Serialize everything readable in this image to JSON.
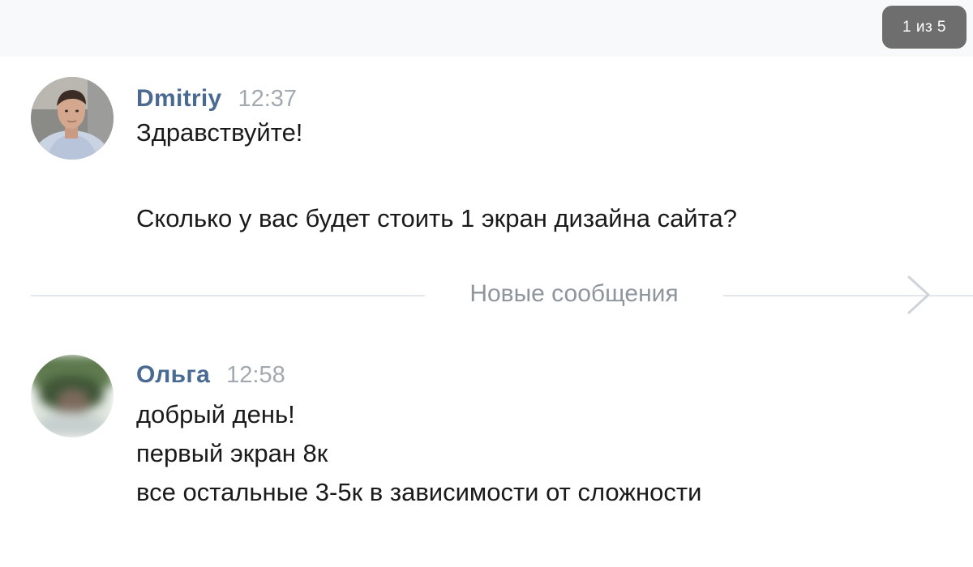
{
  "pagination": {
    "label": "1 из 5"
  },
  "colors": {
    "author": "#4a6a92",
    "time": "#a3a9b0",
    "text": "#1a1a1a",
    "divider_text": "#8e959c",
    "counter_bg": "#6e6e6e"
  },
  "messages": [
    {
      "author": "Dmitriy",
      "time": "12:37",
      "avatar_icon": "user-photo-avatar",
      "lines": [
        "Здравствуйте!",
        "Сколько у вас будет стоить 1 экран дизайна сайта?"
      ]
    },
    {
      "author": "Ольга",
      "time": "12:58",
      "avatar_icon": "blurred-user-avatar",
      "lines": [
        "добрый день!",
        "первый экран 8к",
        "все остальные 3-5к в зависимости от сложности"
      ]
    }
  ],
  "divider": {
    "label": "Новые сообщения",
    "arrow_icon": "chevron-right-icon"
  }
}
